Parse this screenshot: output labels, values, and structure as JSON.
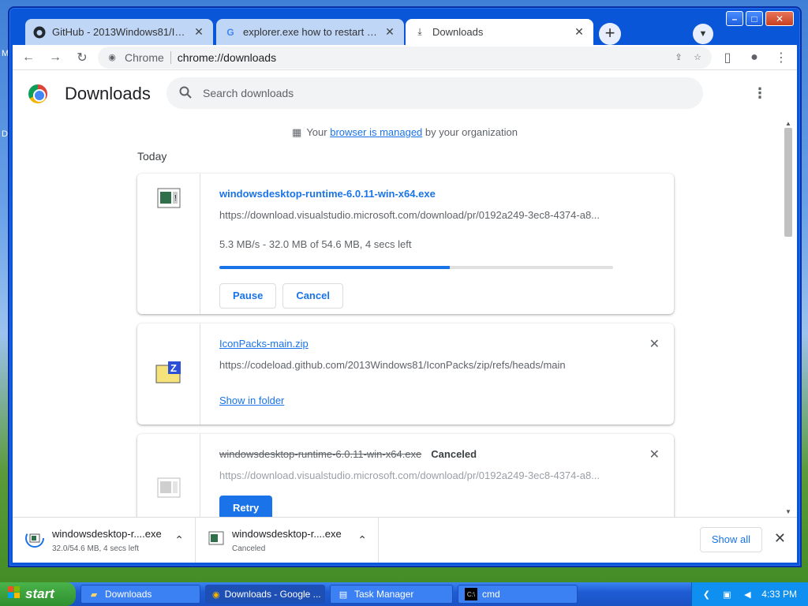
{
  "tabs": [
    {
      "title": "GitHub - 2013Windows81/IconPa",
      "favicon": "github-icon"
    },
    {
      "title": "explorer.exe how to restart - Goo",
      "favicon": "google-icon"
    },
    {
      "title": "Downloads",
      "favicon": "download-icon"
    }
  ],
  "window_buttons": {
    "minimize": "–",
    "maximize": "□",
    "close": "✕"
  },
  "omnibox": {
    "scheme_label": "Chrome",
    "url": "chrome://downloads"
  },
  "page": {
    "title": "Downloads",
    "search_placeholder": "Search downloads",
    "managed_prefix": "Your ",
    "managed_link": "browser is managed",
    "managed_suffix": " by your organization",
    "section_label": "Today"
  },
  "downloads": [
    {
      "filename": "windowsdesktop-runtime-6.0.11-win-x64.exe",
      "url": "https://download.visualstudio.microsoft.com/download/pr/0192a249-3ec8-4374-a8...",
      "status": "5.3 MB/s - 32.0 MB of 54.6 MB, 4 secs left",
      "progress": 0.586,
      "pause_label": "Pause",
      "cancel_label": "Cancel"
    },
    {
      "filename": "IconPacks-main.zip",
      "url": "https://codeload.github.com/2013Windows81/IconPacks/zip/refs/heads/main",
      "show_label": "Show in folder",
      "close_label": "✕"
    },
    {
      "filename": "windowsdesktop-runtime-6.0.11-win-x64.exe",
      "state": "Canceled",
      "url": "https://download.visualstudio.microsoft.com/download/pr/0192a249-3ec8-4374-a8...",
      "retry_label": "Retry",
      "close_label": "✕"
    }
  ],
  "shelf": {
    "items": [
      {
        "name": "windowsdesktop-r....exe",
        "sub": "32.0/54.6 MB, 4 secs left"
      },
      {
        "name": "windowsdesktop-r....exe",
        "sub": "Canceled"
      }
    ],
    "show_all": "Show all",
    "close": "✕"
  },
  "taskbar": {
    "start": "start",
    "tasks": [
      {
        "label": "Downloads",
        "icon": "folder-icon"
      },
      {
        "label": "Downloads - Google ...",
        "icon": "chrome-icon"
      },
      {
        "label": "Task Manager",
        "icon": "task-manager-icon"
      },
      {
        "label": "cmd",
        "icon": "cmd-icon"
      }
    ],
    "clock": "4:33 PM"
  },
  "desktop_letters": [
    "M",
    "D"
  ],
  "colors": {
    "accent": "#1a73e8",
    "xp_blue": "#0a56d8",
    "start_green": "#2f8f2f"
  }
}
